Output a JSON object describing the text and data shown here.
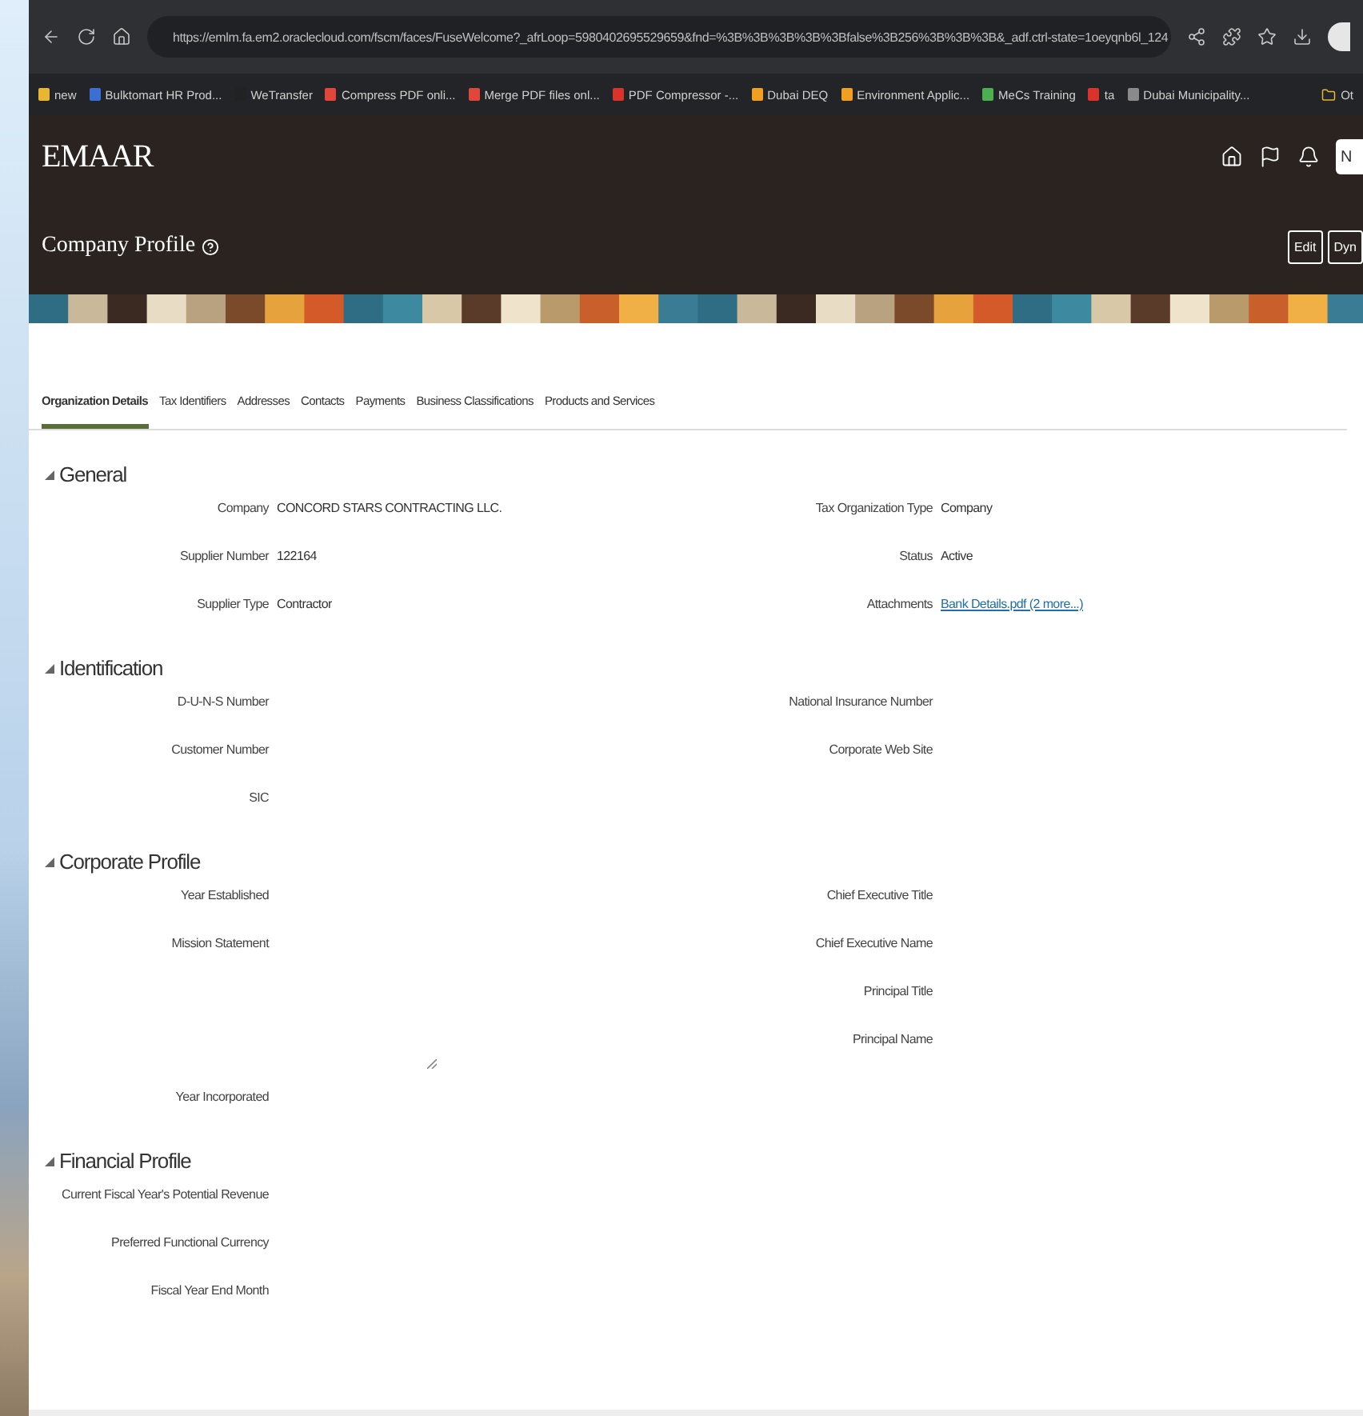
{
  "browser": {
    "url": "https://emlm.fa.em2.oraclecloud.com/fscm/faces/FuseWelcome?_afrLoop=5980402695529659&fnd=%3B%3B%3B%3B%3Bfalse%3B256%3B%3B%3B&_adf.ctrl-state=1oeyqnb6l_124",
    "bookmarks": [
      {
        "label": "new",
        "color": "#e8b630"
      },
      {
        "label": "Bulktomart HR Prod...",
        "color": "#3b6fd1"
      },
      {
        "label": "WeTransfer",
        "color": "#222222"
      },
      {
        "label": "Compress PDF onli...",
        "color": "#e0463a"
      },
      {
        "label": "Merge PDF files onl...",
        "color": "#e0463a"
      },
      {
        "label": "PDF Compressor -...",
        "color": "#d9342b"
      },
      {
        "label": "Dubai DEQ",
        "color": "#f0a020"
      },
      {
        "label": "Environment Applic...",
        "color": "#f0a020"
      },
      {
        "label": "MeCs Training",
        "color": "#4caf50"
      },
      {
        "label": "ta",
        "color": "#d9342b"
      },
      {
        "label": "Dubai Municipality...",
        "color": "#8a8a8a"
      }
    ],
    "other_bookmarks": "Ot"
  },
  "header": {
    "brand": "EMAAR",
    "avatar_initial": "N",
    "page_title": "Company Profile",
    "buttons": [
      "Edit",
      "Dyn"
    ]
  },
  "tabs": [
    {
      "label": "Organization Details",
      "selected": true
    },
    {
      "label": "Tax Identifiers",
      "selected": false
    },
    {
      "label": "Addresses",
      "selected": false
    },
    {
      "label": "Contacts",
      "selected": false
    },
    {
      "label": "Payments",
      "selected": false
    },
    {
      "label": "Business Classifications",
      "selected": false
    },
    {
      "label": "Products and Services",
      "selected": false
    }
  ],
  "sections": [
    {
      "title": "General",
      "expanded": true,
      "left": [
        {
          "label": "Company",
          "value": "CONCORD STARS CONTRACTING LLC.",
          "kind": "text"
        },
        {
          "label": "Supplier Number",
          "value": "122164",
          "kind": "text"
        },
        {
          "label": "Supplier Type",
          "value": "Contractor",
          "kind": "text"
        }
      ],
      "right": [
        {
          "label": "Tax Organization Type",
          "value": "Company",
          "kind": "text"
        },
        {
          "label": "Status",
          "value": "Active",
          "kind": "text"
        },
        {
          "label": "Attachments",
          "value": "Bank Details.pdf (2 more...)",
          "kind": "link"
        }
      ]
    },
    {
      "title": "Identification",
      "expanded": true,
      "left": [
        {
          "label": "D-U-N-S Number",
          "kind": "text"
        },
        {
          "label": "Customer Number",
          "kind": "text"
        },
        {
          "label": "SIC",
          "kind": "text"
        }
      ],
      "right": [
        {
          "label": "National Insurance Number",
          "kind": "text"
        },
        {
          "label": "Corporate Web Site",
          "kind": "text"
        }
      ]
    },
    {
      "title": "Corporate Profile",
      "expanded": true,
      "left": [
        {
          "label": "Year Established",
          "kind": "text"
        },
        {
          "label": "Mission Statement",
          "kind": "multiline"
        },
        {
          "label": "Year Incorporated",
          "kind": "text"
        }
      ],
      "right": [
        {
          "label": "Chief Executive Title",
          "kind": "text"
        },
        {
          "label": "Chief Executive Name",
          "kind": "text"
        },
        {
          "label": "Principal Title",
          "kind": "text"
        },
        {
          "label": "Principal Name",
          "kind": "text"
        }
      ]
    },
    {
      "title": "Financial Profile",
      "expanded": true,
      "left": [
        {
          "label": "Current Fiscal Year's Potential Revenue",
          "kind": "text"
        },
        {
          "label": "Preferred Functional Currency",
          "kind": "text"
        },
        {
          "label": "Fiscal Year End Month",
          "kind": "text"
        }
      ]
    }
  ]
}
